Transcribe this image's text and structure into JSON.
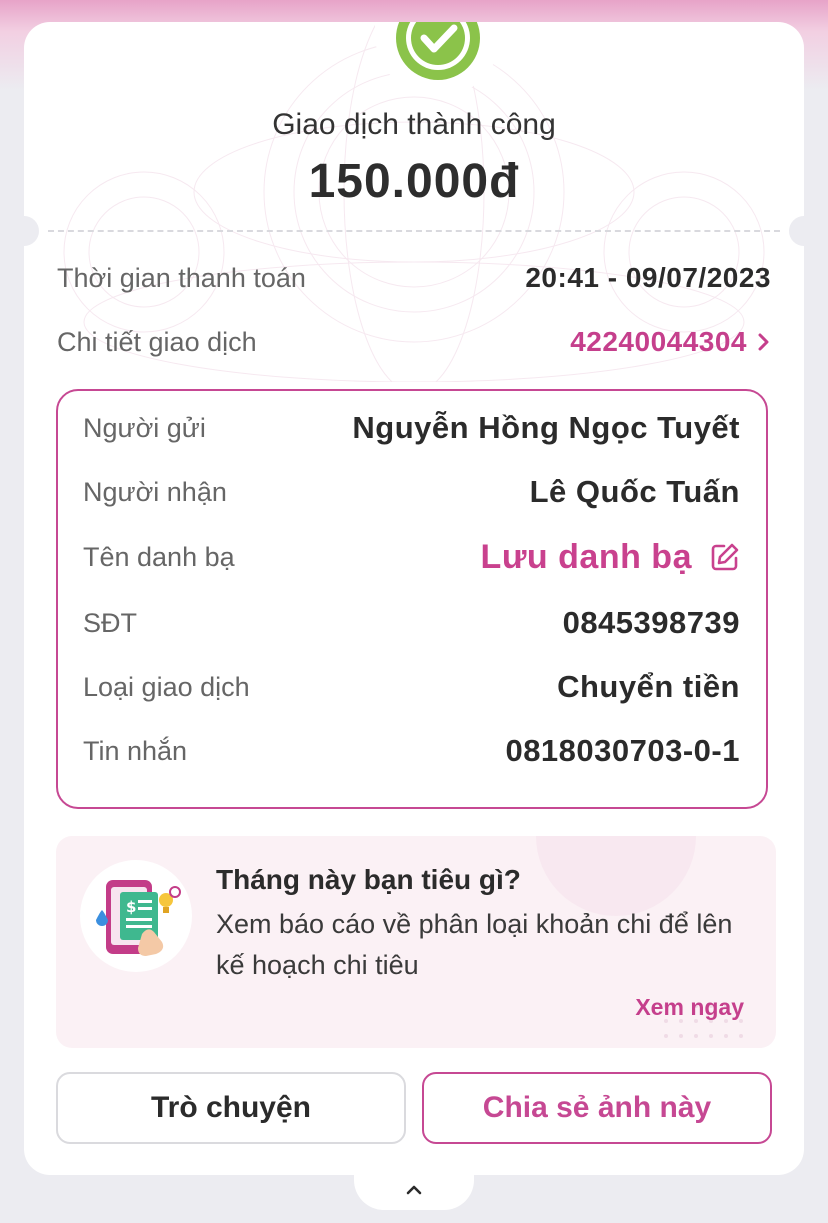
{
  "header": {
    "title": "Giao dịch thành công",
    "amount": "150.000đ"
  },
  "summary": {
    "time_label": "Thời gian thanh toán",
    "time_value": "20:41 - 09/07/2023",
    "detail_label": "Chi tiết giao dịch",
    "detail_value": "42240044304"
  },
  "details": {
    "rows": [
      {
        "label": "Người gửi",
        "value": "Nguyễn Hồng Ngọc Tuyết"
      },
      {
        "label": "Người nhận",
        "value": "Lê Quốc Tuấn"
      },
      {
        "label": "Tên danh bạ",
        "value": "Lưu danh bạ"
      },
      {
        "label": "SĐT",
        "value": "0845398739"
      },
      {
        "label": "Loại giao dịch",
        "value": "Chuyển tiền"
      },
      {
        "label": "Tin nhắn",
        "value": "0818030703-0-1"
      }
    ]
  },
  "promo": {
    "title": "Tháng này bạn tiêu gì?",
    "description": "Xem báo cáo về phân loại khoản chi để lên kế hoạch chi tiêu",
    "link": "Xem ngay"
  },
  "actions": {
    "chat_label": "Trò chuyện",
    "share_label": "Chia sẻ ảnh này"
  },
  "icons": {
    "success": "check-circle-icon",
    "chevron": "chevron-right-icon",
    "edit": "edit-icon",
    "promo": "spending-report-icon",
    "collapse": "chevron-up-icon"
  },
  "colors": {
    "accent": "#c53f8c",
    "success": "#7bbf2f",
    "background": "#ececf1"
  }
}
